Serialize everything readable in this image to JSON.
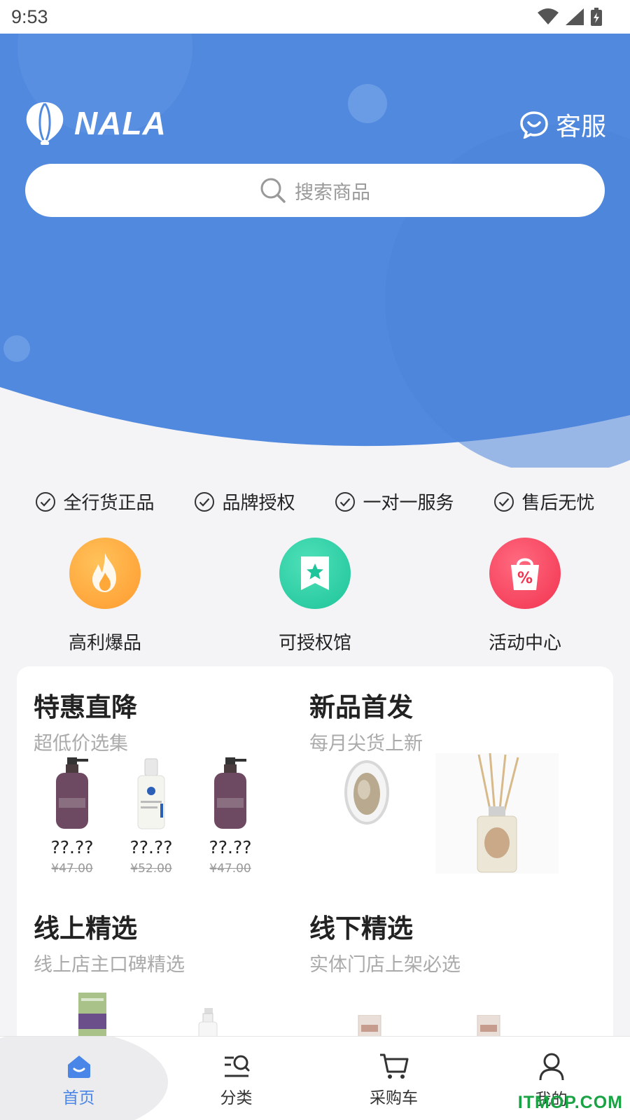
{
  "status_bar": {
    "time": "9:53"
  },
  "header": {
    "logo_text": "NALA",
    "service_label": "客服",
    "search_placeholder": "搜索商品"
  },
  "guarantees": [
    "全行货正品",
    "品牌授权",
    "一对一服务",
    "售后无忧"
  ],
  "categories": [
    {
      "label": "高利爆品",
      "icon": "fire-icon",
      "color": "#ffa83a"
    },
    {
      "label": "可授权馆",
      "icon": "bookmark-star-icon",
      "color": "#2ecfa3"
    },
    {
      "label": "活动中心",
      "icon": "shopping-bag-percent-icon",
      "color": "#f5425e"
    }
  ],
  "sections": {
    "sale": {
      "title": "特惠直降",
      "subtitle": "超低价选集",
      "products": [
        {
          "price": "??.??",
          "old_price": "¥47.00"
        },
        {
          "price": "??.??",
          "old_price": "¥52.00"
        },
        {
          "price": "??.??",
          "old_price": "¥47.00"
        }
      ]
    },
    "new": {
      "title": "新品首发",
      "subtitle": "每月尖货上新"
    },
    "online": {
      "title": "线上精选",
      "subtitle": "线上店主口碑精选"
    },
    "offline": {
      "title": "线下精选",
      "subtitle": "实体门店上架必选"
    }
  },
  "bottom_nav": [
    {
      "label": "首页",
      "icon": "home-icon",
      "active": true
    },
    {
      "label": "分类",
      "icon": "category-search-icon"
    },
    {
      "label": "采购车",
      "icon": "cart-icon"
    },
    {
      "label": "我的",
      "icon": "user-icon"
    }
  ],
  "watermark": "ITMOP.COM",
  "colors": {
    "brand_blue": "#5189de",
    "active_tab": "#4a86e8"
  }
}
